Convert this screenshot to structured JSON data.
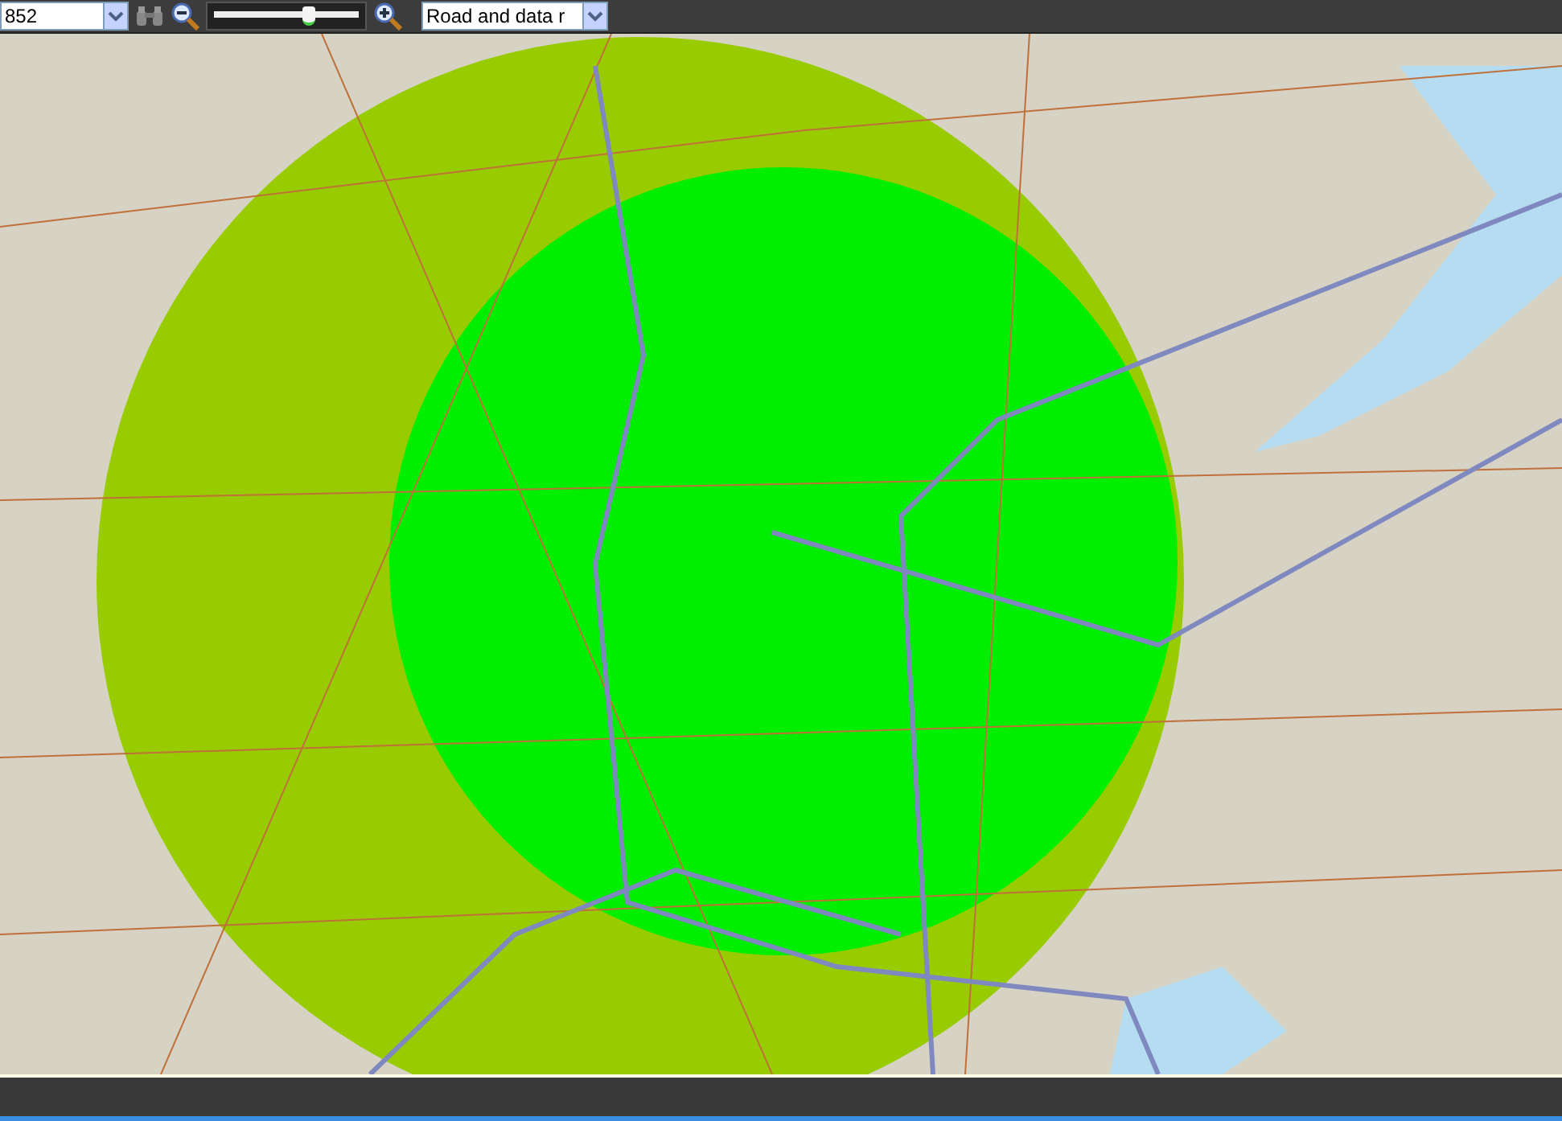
{
  "toolbar": {
    "location_field": {
      "value": "852"
    },
    "zoom_slider": {
      "level": 0.65
    },
    "map_style_field": {
      "value": "Road and data r"
    }
  }
}
